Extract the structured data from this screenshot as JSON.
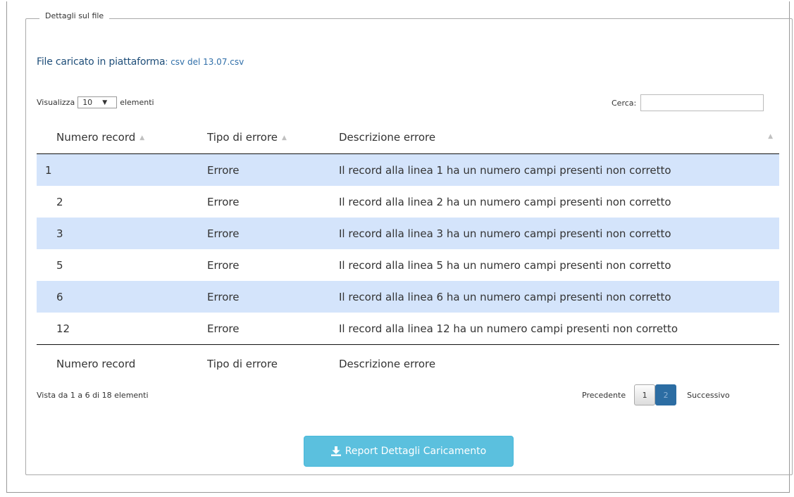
{
  "panel": {
    "legend": "Dettagli sul file",
    "file_label": "File caricato in piattaforma",
    "file_separator": ": ",
    "file_name": "csv del 13.07.csv"
  },
  "length_control": {
    "prefix": "Visualizza",
    "value": "10",
    "suffix": "elementi"
  },
  "search": {
    "label": "Cerca:",
    "value": ""
  },
  "table": {
    "headers": [
      "Numero record",
      "Tipo di errore",
      "Descrizione errore"
    ],
    "rows": [
      {
        "record": "1",
        "type": "Errore",
        "description": "Il record alla linea 1 ha un numero campi presenti non corretto"
      },
      {
        "record": "2",
        "type": "Errore",
        "description": "Il record alla linea 2 ha un numero campi presenti non corretto"
      },
      {
        "record": "3",
        "type": "Errore",
        "description": "Il record alla linea 3 ha un numero campi presenti non corretto"
      },
      {
        "record": "5",
        "type": "Errore",
        "description": "Il record alla linea 5 ha un numero campi presenti non corretto"
      },
      {
        "record": "6",
        "type": "Errore",
        "description": "Il record alla linea 6 ha un numero campi presenti non corretto"
      },
      {
        "record": "12",
        "type": "Errore",
        "description": "Il record alla linea 12 ha un numero campi presenti non corretto"
      }
    ],
    "footers": [
      "Numero record",
      "Tipo di errore",
      "Descrizione errore"
    ]
  },
  "info": "Vista da 1 a 6 di 18 elementi",
  "pagination": {
    "previous": "Precedente",
    "pages": [
      "1",
      "2"
    ],
    "current_page": "2",
    "next": "Successivo"
  },
  "report_button": {
    "label": "Report Dettagli Caricamento",
    "icon": "download-icon"
  },
  "colors": {
    "row_highlight": "#d4e4fb",
    "button": "#5bc0de",
    "active_page": "#2c6da3",
    "file_label": "#1f4e79"
  }
}
